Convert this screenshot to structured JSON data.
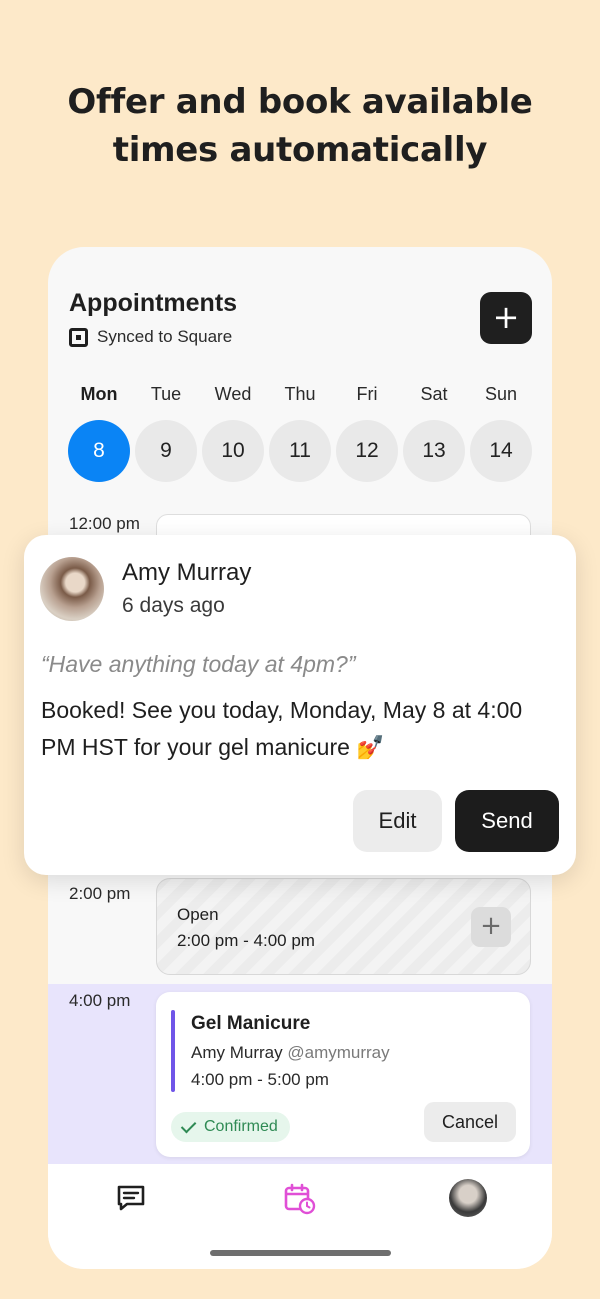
{
  "headline": {
    "line1": "Offer and book available",
    "line2": "times automatically"
  },
  "header": {
    "title": "Appointments",
    "sync_text": "Synced to Square",
    "add_label": "+"
  },
  "week": [
    {
      "dow": "Mon",
      "date": "8",
      "selected": true
    },
    {
      "dow": "Tue",
      "date": "9",
      "selected": false
    },
    {
      "dow": "Wed",
      "date": "10",
      "selected": false
    },
    {
      "dow": "Thu",
      "date": "11",
      "selected": false
    },
    {
      "dow": "Fri",
      "date": "12",
      "selected": false
    },
    {
      "dow": "Sat",
      "date": "13",
      "selected": false
    },
    {
      "dow": "Sun",
      "date": "14",
      "selected": false
    }
  ],
  "schedule": {
    "times": [
      "12:00 pm",
      "2:00 pm",
      "4:00 pm"
    ],
    "open_slot": {
      "title": "Open",
      "range": "2:00 pm - 4:00 pm",
      "add_label": "+"
    },
    "booking": {
      "service": "Gel Manicure",
      "client": "Amy Murray",
      "handle": "@amymurray",
      "time": "4:00 pm - 5:00 pm",
      "status": "Confirmed",
      "cancel_label": "Cancel"
    }
  },
  "message": {
    "sender": "Amy Murray",
    "ago": "6 days ago",
    "quote": "“Have anything today at 4pm?”",
    "reply": "Booked! See you today, Monday, May 8 at 4:00 PM HST for your gel manicure 💅",
    "edit_label": "Edit",
    "send_label": "Send"
  },
  "tabs": [
    "messages-icon",
    "calendar-icon",
    "profile-avatar"
  ],
  "colors": {
    "background": "#fde9c9",
    "accent_blue": "#0a84f5",
    "accent_purple": "#6f55e8",
    "booked_band": "#e8e4fc",
    "calendar_tab": "#e04fd6",
    "confirmed_green": "#2f8a54"
  }
}
